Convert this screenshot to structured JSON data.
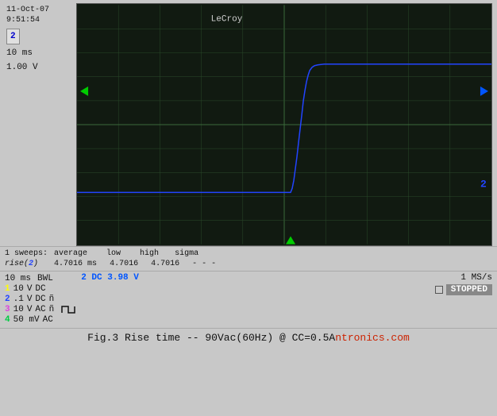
{
  "timestamp": {
    "date": "11-Oct-07",
    "time": "9:51:54"
  },
  "channel_box": "2",
  "ch_settings": {
    "time_div": "10 ms",
    "volt_div": "1.00 V"
  },
  "scope_label": "LeCroy",
  "measurements": {
    "sweeps": "1 sweeps:",
    "columns": [
      "average",
      "low",
      "high",
      "sigma"
    ],
    "rise2_label": "rise(2)",
    "rise2_values": [
      "4.7016 ms",
      "4.7016",
      "4.7016",
      "- - -"
    ]
  },
  "status": {
    "timebase": "10 ms",
    "bwl": "BWL",
    "channels": [
      {
        "num": "1",
        "volt": "10",
        "unit": "V",
        "coupling": "DC"
      },
      {
        "num": "2",
        "volt": ".1",
        "unit": "V",
        "coupling": "DC",
        "extra": "ñ"
      },
      {
        "num": "3",
        "volt": "10",
        "unit": "V",
        "coupling": "AC",
        "extra": "ñ"
      },
      {
        "num": "4",
        "volt": "50 mV",
        "coupling": "AC"
      }
    ],
    "ch2_dc_label": "2 DC 3.98 V",
    "sample_rate": "1 MS/s",
    "mode": "STOPPED"
  },
  "caption": {
    "text": "Fig.3  Rise time  --  90Vac(60Hz) @  CC=0.5A",
    "brand": "ntronics.com"
  }
}
